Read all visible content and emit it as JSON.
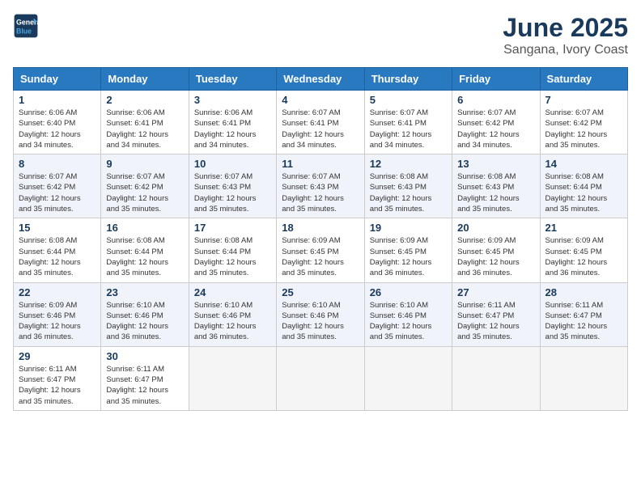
{
  "header": {
    "logo_line1": "General",
    "logo_line2": "Blue",
    "title": "June 2025",
    "subtitle": "Sangana, Ivory Coast"
  },
  "weekdays": [
    "Sunday",
    "Monday",
    "Tuesday",
    "Wednesday",
    "Thursday",
    "Friday",
    "Saturday"
  ],
  "weeks": [
    [
      {
        "day": "1",
        "info": "Sunrise: 6:06 AM\nSunset: 6:40 PM\nDaylight: 12 hours\nand 34 minutes."
      },
      {
        "day": "2",
        "info": "Sunrise: 6:06 AM\nSunset: 6:41 PM\nDaylight: 12 hours\nand 34 minutes."
      },
      {
        "day": "3",
        "info": "Sunrise: 6:06 AM\nSunset: 6:41 PM\nDaylight: 12 hours\nand 34 minutes."
      },
      {
        "day": "4",
        "info": "Sunrise: 6:07 AM\nSunset: 6:41 PM\nDaylight: 12 hours\nand 34 minutes."
      },
      {
        "day": "5",
        "info": "Sunrise: 6:07 AM\nSunset: 6:41 PM\nDaylight: 12 hours\nand 34 minutes."
      },
      {
        "day": "6",
        "info": "Sunrise: 6:07 AM\nSunset: 6:42 PM\nDaylight: 12 hours\nand 34 minutes."
      },
      {
        "day": "7",
        "info": "Sunrise: 6:07 AM\nSunset: 6:42 PM\nDaylight: 12 hours\nand 35 minutes."
      }
    ],
    [
      {
        "day": "8",
        "info": "Sunrise: 6:07 AM\nSunset: 6:42 PM\nDaylight: 12 hours\nand 35 minutes."
      },
      {
        "day": "9",
        "info": "Sunrise: 6:07 AM\nSunset: 6:42 PM\nDaylight: 12 hours\nand 35 minutes."
      },
      {
        "day": "10",
        "info": "Sunrise: 6:07 AM\nSunset: 6:43 PM\nDaylight: 12 hours\nand 35 minutes."
      },
      {
        "day": "11",
        "info": "Sunrise: 6:07 AM\nSunset: 6:43 PM\nDaylight: 12 hours\nand 35 minutes."
      },
      {
        "day": "12",
        "info": "Sunrise: 6:08 AM\nSunset: 6:43 PM\nDaylight: 12 hours\nand 35 minutes."
      },
      {
        "day": "13",
        "info": "Sunrise: 6:08 AM\nSunset: 6:43 PM\nDaylight: 12 hours\nand 35 minutes."
      },
      {
        "day": "14",
        "info": "Sunrise: 6:08 AM\nSunset: 6:44 PM\nDaylight: 12 hours\nand 35 minutes."
      }
    ],
    [
      {
        "day": "15",
        "info": "Sunrise: 6:08 AM\nSunset: 6:44 PM\nDaylight: 12 hours\nand 35 minutes."
      },
      {
        "day": "16",
        "info": "Sunrise: 6:08 AM\nSunset: 6:44 PM\nDaylight: 12 hours\nand 35 minutes."
      },
      {
        "day": "17",
        "info": "Sunrise: 6:08 AM\nSunset: 6:44 PM\nDaylight: 12 hours\nand 35 minutes."
      },
      {
        "day": "18",
        "info": "Sunrise: 6:09 AM\nSunset: 6:45 PM\nDaylight: 12 hours\nand 35 minutes."
      },
      {
        "day": "19",
        "info": "Sunrise: 6:09 AM\nSunset: 6:45 PM\nDaylight: 12 hours\nand 36 minutes."
      },
      {
        "day": "20",
        "info": "Sunrise: 6:09 AM\nSunset: 6:45 PM\nDaylight: 12 hours\nand 36 minutes."
      },
      {
        "day": "21",
        "info": "Sunrise: 6:09 AM\nSunset: 6:45 PM\nDaylight: 12 hours\nand 36 minutes."
      }
    ],
    [
      {
        "day": "22",
        "info": "Sunrise: 6:09 AM\nSunset: 6:46 PM\nDaylight: 12 hours\nand 36 minutes."
      },
      {
        "day": "23",
        "info": "Sunrise: 6:10 AM\nSunset: 6:46 PM\nDaylight: 12 hours\nand 36 minutes."
      },
      {
        "day": "24",
        "info": "Sunrise: 6:10 AM\nSunset: 6:46 PM\nDaylight: 12 hours\nand 36 minutes."
      },
      {
        "day": "25",
        "info": "Sunrise: 6:10 AM\nSunset: 6:46 PM\nDaylight: 12 hours\nand 35 minutes."
      },
      {
        "day": "26",
        "info": "Sunrise: 6:10 AM\nSunset: 6:46 PM\nDaylight: 12 hours\nand 35 minutes."
      },
      {
        "day": "27",
        "info": "Sunrise: 6:11 AM\nSunset: 6:47 PM\nDaylight: 12 hours\nand 35 minutes."
      },
      {
        "day": "28",
        "info": "Sunrise: 6:11 AM\nSunset: 6:47 PM\nDaylight: 12 hours\nand 35 minutes."
      }
    ],
    [
      {
        "day": "29",
        "info": "Sunrise: 6:11 AM\nSunset: 6:47 PM\nDaylight: 12 hours\nand 35 minutes."
      },
      {
        "day": "30",
        "info": "Sunrise: 6:11 AM\nSunset: 6:47 PM\nDaylight: 12 hours\nand 35 minutes."
      },
      {
        "day": "",
        "info": ""
      },
      {
        "day": "",
        "info": ""
      },
      {
        "day": "",
        "info": ""
      },
      {
        "day": "",
        "info": ""
      },
      {
        "day": "",
        "info": ""
      }
    ]
  ]
}
